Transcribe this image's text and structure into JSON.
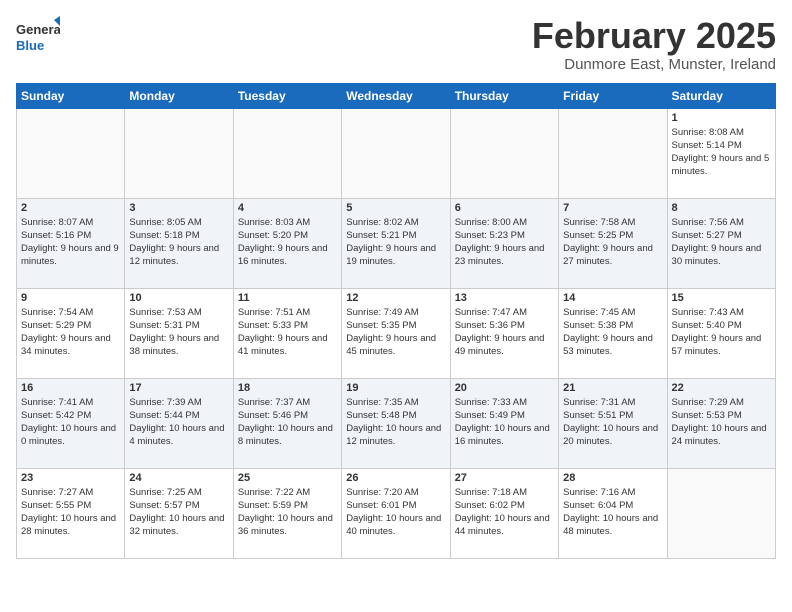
{
  "header": {
    "logo_line1": "General",
    "logo_line2": "Blue",
    "title": "February 2025",
    "subtitle": "Dunmore East, Munster, Ireland"
  },
  "days_of_week": [
    "Sunday",
    "Monday",
    "Tuesday",
    "Wednesday",
    "Thursday",
    "Friday",
    "Saturday"
  ],
  "weeks": [
    [
      {
        "num": "",
        "info": ""
      },
      {
        "num": "",
        "info": ""
      },
      {
        "num": "",
        "info": ""
      },
      {
        "num": "",
        "info": ""
      },
      {
        "num": "",
        "info": ""
      },
      {
        "num": "",
        "info": ""
      },
      {
        "num": "1",
        "info": "Sunrise: 8:08 AM\nSunset: 5:14 PM\nDaylight: 9 hours and 5 minutes."
      }
    ],
    [
      {
        "num": "2",
        "info": "Sunrise: 8:07 AM\nSunset: 5:16 PM\nDaylight: 9 hours and 9 minutes."
      },
      {
        "num": "3",
        "info": "Sunrise: 8:05 AM\nSunset: 5:18 PM\nDaylight: 9 hours and 12 minutes."
      },
      {
        "num": "4",
        "info": "Sunrise: 8:03 AM\nSunset: 5:20 PM\nDaylight: 9 hours and 16 minutes."
      },
      {
        "num": "5",
        "info": "Sunrise: 8:02 AM\nSunset: 5:21 PM\nDaylight: 9 hours and 19 minutes."
      },
      {
        "num": "6",
        "info": "Sunrise: 8:00 AM\nSunset: 5:23 PM\nDaylight: 9 hours and 23 minutes."
      },
      {
        "num": "7",
        "info": "Sunrise: 7:58 AM\nSunset: 5:25 PM\nDaylight: 9 hours and 27 minutes."
      },
      {
        "num": "8",
        "info": "Sunrise: 7:56 AM\nSunset: 5:27 PM\nDaylight: 9 hours and 30 minutes."
      }
    ],
    [
      {
        "num": "9",
        "info": "Sunrise: 7:54 AM\nSunset: 5:29 PM\nDaylight: 9 hours and 34 minutes."
      },
      {
        "num": "10",
        "info": "Sunrise: 7:53 AM\nSunset: 5:31 PM\nDaylight: 9 hours and 38 minutes."
      },
      {
        "num": "11",
        "info": "Sunrise: 7:51 AM\nSunset: 5:33 PM\nDaylight: 9 hours and 41 minutes."
      },
      {
        "num": "12",
        "info": "Sunrise: 7:49 AM\nSunset: 5:35 PM\nDaylight: 9 hours and 45 minutes."
      },
      {
        "num": "13",
        "info": "Sunrise: 7:47 AM\nSunset: 5:36 PM\nDaylight: 9 hours and 49 minutes."
      },
      {
        "num": "14",
        "info": "Sunrise: 7:45 AM\nSunset: 5:38 PM\nDaylight: 9 hours and 53 minutes."
      },
      {
        "num": "15",
        "info": "Sunrise: 7:43 AM\nSunset: 5:40 PM\nDaylight: 9 hours and 57 minutes."
      }
    ],
    [
      {
        "num": "16",
        "info": "Sunrise: 7:41 AM\nSunset: 5:42 PM\nDaylight: 10 hours and 0 minutes."
      },
      {
        "num": "17",
        "info": "Sunrise: 7:39 AM\nSunset: 5:44 PM\nDaylight: 10 hours and 4 minutes."
      },
      {
        "num": "18",
        "info": "Sunrise: 7:37 AM\nSunset: 5:46 PM\nDaylight: 10 hours and 8 minutes."
      },
      {
        "num": "19",
        "info": "Sunrise: 7:35 AM\nSunset: 5:48 PM\nDaylight: 10 hours and 12 minutes."
      },
      {
        "num": "20",
        "info": "Sunrise: 7:33 AM\nSunset: 5:49 PM\nDaylight: 10 hours and 16 minutes."
      },
      {
        "num": "21",
        "info": "Sunrise: 7:31 AM\nSunset: 5:51 PM\nDaylight: 10 hours and 20 minutes."
      },
      {
        "num": "22",
        "info": "Sunrise: 7:29 AM\nSunset: 5:53 PM\nDaylight: 10 hours and 24 minutes."
      }
    ],
    [
      {
        "num": "23",
        "info": "Sunrise: 7:27 AM\nSunset: 5:55 PM\nDaylight: 10 hours and 28 minutes."
      },
      {
        "num": "24",
        "info": "Sunrise: 7:25 AM\nSunset: 5:57 PM\nDaylight: 10 hours and 32 minutes."
      },
      {
        "num": "25",
        "info": "Sunrise: 7:22 AM\nSunset: 5:59 PM\nDaylight: 10 hours and 36 minutes."
      },
      {
        "num": "26",
        "info": "Sunrise: 7:20 AM\nSunset: 6:01 PM\nDaylight: 10 hours and 40 minutes."
      },
      {
        "num": "27",
        "info": "Sunrise: 7:18 AM\nSunset: 6:02 PM\nDaylight: 10 hours and 44 minutes."
      },
      {
        "num": "28",
        "info": "Sunrise: 7:16 AM\nSunset: 6:04 PM\nDaylight: 10 hours and 48 minutes."
      },
      {
        "num": "",
        "info": ""
      }
    ]
  ]
}
